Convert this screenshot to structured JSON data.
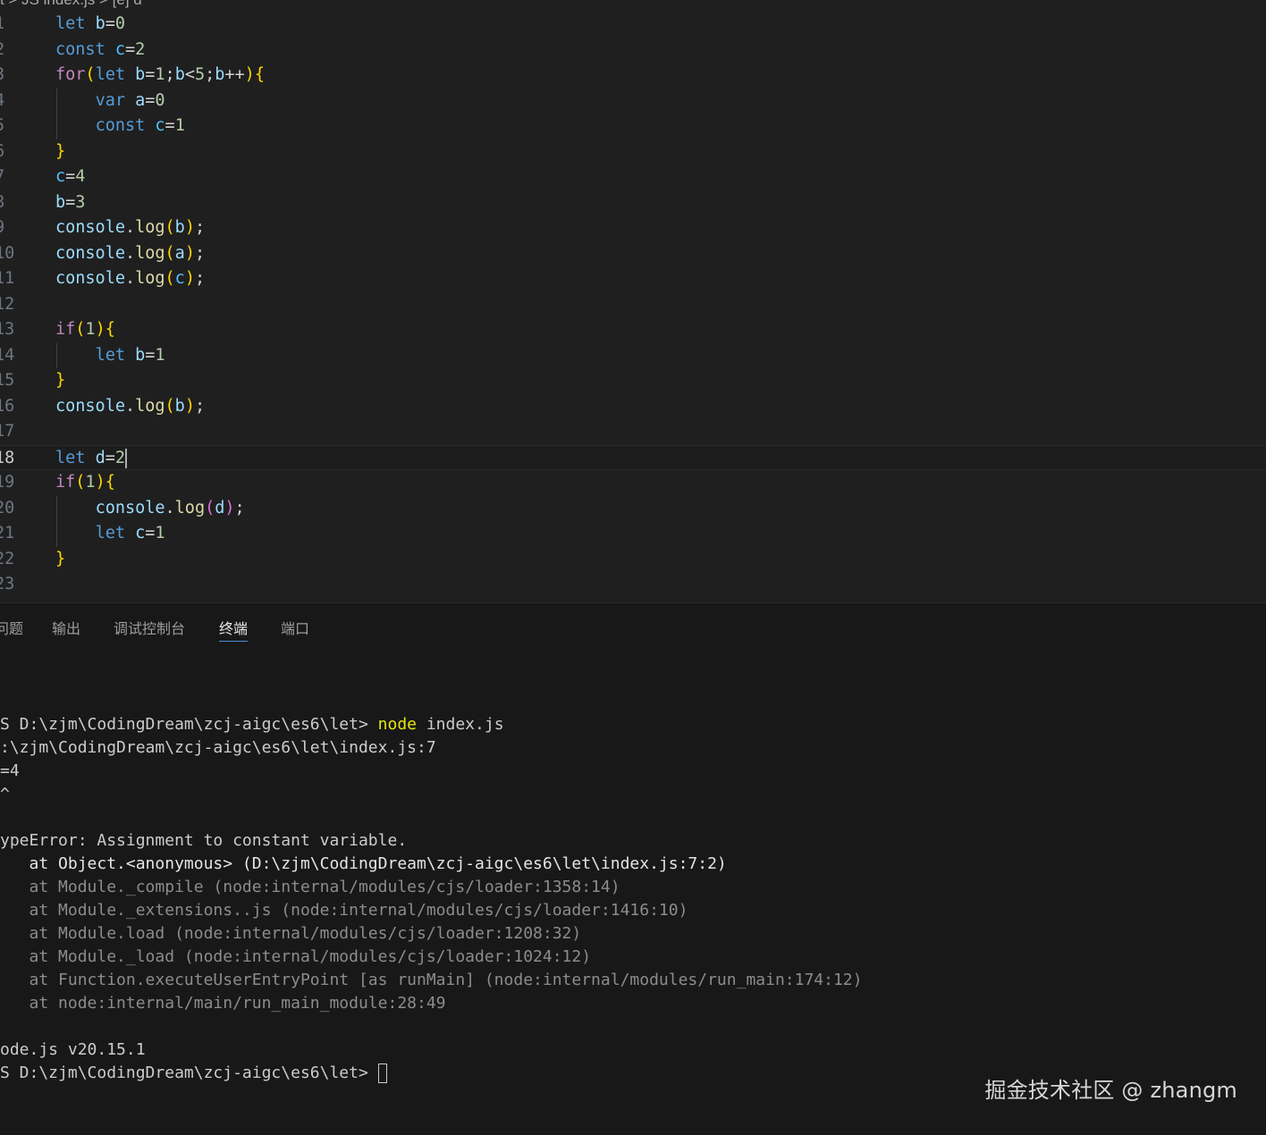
{
  "editor": {
    "breadcrumb": "t > JS index.js > [e] d",
    "lines": [
      {
        "n": "1",
        "tokens": [
          [
            "kw",
            "let"
          ],
          [
            "op",
            " "
          ],
          [
            "var",
            "b"
          ],
          [
            "op",
            "="
          ],
          [
            "num",
            "0"
          ]
        ]
      },
      {
        "n": "2",
        "tokens": [
          [
            "kw",
            "const"
          ],
          [
            "op",
            " "
          ],
          [
            "cn",
            "c"
          ],
          [
            "op",
            "="
          ],
          [
            "num",
            "2"
          ]
        ]
      },
      {
        "n": "3",
        "tokens": [
          [
            "ctl",
            "for"
          ],
          [
            "b1",
            "("
          ],
          [
            "kw",
            "let"
          ],
          [
            "op",
            " "
          ],
          [
            "var",
            "b"
          ],
          [
            "op",
            "="
          ],
          [
            "num",
            "1"
          ],
          [
            "op",
            ";"
          ],
          [
            "var",
            "b"
          ],
          [
            "op",
            "<"
          ],
          [
            "num",
            "5"
          ],
          [
            "op",
            ";"
          ],
          [
            "var",
            "b"
          ],
          [
            "op",
            "++"
          ],
          [
            "b1",
            ")"
          ],
          [
            "b1",
            "{"
          ]
        ]
      },
      {
        "n": "4",
        "tokens": [
          [
            "op",
            "    "
          ],
          [
            "kw",
            "var"
          ],
          [
            "op",
            " "
          ],
          [
            "var",
            "a"
          ],
          [
            "op",
            "="
          ],
          [
            "num",
            "0"
          ]
        ]
      },
      {
        "n": "5",
        "tokens": [
          [
            "op",
            "    "
          ],
          [
            "kw",
            "const"
          ],
          [
            "op",
            " "
          ],
          [
            "cn",
            "c"
          ],
          [
            "op",
            "="
          ],
          [
            "num",
            "1"
          ]
        ]
      },
      {
        "n": "6",
        "tokens": [
          [
            "b1",
            "}"
          ]
        ]
      },
      {
        "n": "7",
        "tokens": [
          [
            "cn",
            "c"
          ],
          [
            "op",
            "="
          ],
          [
            "num",
            "4"
          ]
        ]
      },
      {
        "n": "8",
        "tokens": [
          [
            "var",
            "b"
          ],
          [
            "op",
            "="
          ],
          [
            "num",
            "3"
          ]
        ]
      },
      {
        "n": "9",
        "tokens": [
          [
            "var",
            "console"
          ],
          [
            "op",
            "."
          ],
          [
            "fn",
            "log"
          ],
          [
            "b1",
            "("
          ],
          [
            "var",
            "b"
          ],
          [
            "b1",
            ")"
          ],
          [
            "op",
            ";"
          ]
        ]
      },
      {
        "n": "10",
        "tokens": [
          [
            "var",
            "console"
          ],
          [
            "op",
            "."
          ],
          [
            "fn",
            "log"
          ],
          [
            "b1",
            "("
          ],
          [
            "var",
            "a"
          ],
          [
            "b1",
            ")"
          ],
          [
            "op",
            ";"
          ]
        ]
      },
      {
        "n": "11",
        "tokens": [
          [
            "var",
            "console"
          ],
          [
            "op",
            "."
          ],
          [
            "fn",
            "log"
          ],
          [
            "b1",
            "("
          ],
          [
            "cn",
            "c"
          ],
          [
            "b1",
            ")"
          ],
          [
            "op",
            ";"
          ]
        ]
      },
      {
        "n": "12",
        "tokens": []
      },
      {
        "n": "13",
        "tokens": [
          [
            "ctl",
            "if"
          ],
          [
            "b1",
            "("
          ],
          [
            "num",
            "1"
          ],
          [
            "b1",
            ")"
          ],
          [
            "b1",
            "{"
          ]
        ]
      },
      {
        "n": "14",
        "tokens": [
          [
            "op",
            "    "
          ],
          [
            "kw",
            "let"
          ],
          [
            "op",
            " "
          ],
          [
            "var",
            "b"
          ],
          [
            "op",
            "="
          ],
          [
            "num",
            "1"
          ]
        ]
      },
      {
        "n": "15",
        "tokens": [
          [
            "b1",
            "}"
          ]
        ]
      },
      {
        "n": "16",
        "tokens": [
          [
            "var",
            "console"
          ],
          [
            "op",
            "."
          ],
          [
            "fn",
            "log"
          ],
          [
            "b1",
            "("
          ],
          [
            "var",
            "b"
          ],
          [
            "b1",
            ")"
          ],
          [
            "op",
            ";"
          ]
        ]
      },
      {
        "n": "17",
        "tokens": []
      },
      {
        "n": "18",
        "tokens": [
          [
            "kw",
            "let"
          ],
          [
            "op",
            " "
          ],
          [
            "var",
            "d"
          ],
          [
            "op",
            "="
          ],
          [
            "num",
            "2"
          ]
        ],
        "current": true
      },
      {
        "n": "19",
        "tokens": [
          [
            "ctl",
            "if"
          ],
          [
            "b1",
            "("
          ],
          [
            "num",
            "1"
          ],
          [
            "b1",
            ")"
          ],
          [
            "b1",
            "{"
          ]
        ]
      },
      {
        "n": "20",
        "tokens": [
          [
            "op",
            "    "
          ],
          [
            "var",
            "console"
          ],
          [
            "op",
            "."
          ],
          [
            "fn",
            "log"
          ],
          [
            "b2",
            "("
          ],
          [
            "var",
            "d"
          ],
          [
            "b2",
            ")"
          ],
          [
            "op",
            ";"
          ]
        ]
      },
      {
        "n": "21",
        "tokens": [
          [
            "op",
            "    "
          ],
          [
            "kw",
            "let"
          ],
          [
            "op",
            " "
          ],
          [
            "var",
            "c"
          ],
          [
            "op",
            "="
          ],
          [
            "num",
            "1"
          ]
        ]
      },
      {
        "n": "22",
        "tokens": [
          [
            "b1",
            "}"
          ]
        ]
      },
      {
        "n": "23",
        "tokens": []
      }
    ]
  },
  "panel": {
    "tabs": [
      {
        "label": "问题",
        "active": false
      },
      {
        "label": "输出",
        "active": false
      },
      {
        "label": "调试控制台",
        "active": false
      },
      {
        "label": "终端",
        "active": true
      },
      {
        "label": "端口",
        "active": false
      }
    ]
  },
  "terminal": {
    "prompt_cmd_path": "S D:\\zjm\\CodingDream\\zcj-aigc\\es6\\let> ",
    "prompt_cmd": "node index.js",
    "lines": [
      {
        "text": ":\\zjm\\CodingDream\\zcj-aigc\\es6\\let\\index.js:7",
        "style": "normal"
      },
      {
        "text": "=4",
        "style": "normal"
      },
      {
        "text": "^",
        "style": "normal"
      },
      {
        "text": "",
        "style": "normal"
      },
      {
        "text": "ypeError: Assignment to constant variable.",
        "style": "normal"
      },
      {
        "text": "   at Object.<anonymous> (D:\\zjm\\CodingDream\\zcj-aigc\\es6\\let\\index.js:7:2)",
        "style": "bright"
      },
      {
        "text": "   at Module._compile (node:internal/modules/cjs/loader:1358:14)",
        "style": "dim"
      },
      {
        "text": "   at Module._extensions..js (node:internal/modules/cjs/loader:1416:10)",
        "style": "dim"
      },
      {
        "text": "   at Module.load (node:internal/modules/cjs/loader:1208:32)",
        "style": "dim"
      },
      {
        "text": "   at Module._load (node:internal/modules/cjs/loader:1024:12)",
        "style": "dim"
      },
      {
        "text": "   at Function.executeUserEntryPoint [as runMain] (node:internal/modules/run_main:174:12)",
        "style": "dim"
      },
      {
        "text": "   at node:internal/main/run_main_module:28:49",
        "style": "dim"
      },
      {
        "text": "",
        "style": "normal"
      },
      {
        "text": "ode.js v20.15.1",
        "style": "normal"
      }
    ],
    "final_prompt": "S D:\\zjm\\CodingDream\\zcj-aigc\\es6\\let> "
  },
  "watermark": "掘金技术社区 @ zhangm"
}
